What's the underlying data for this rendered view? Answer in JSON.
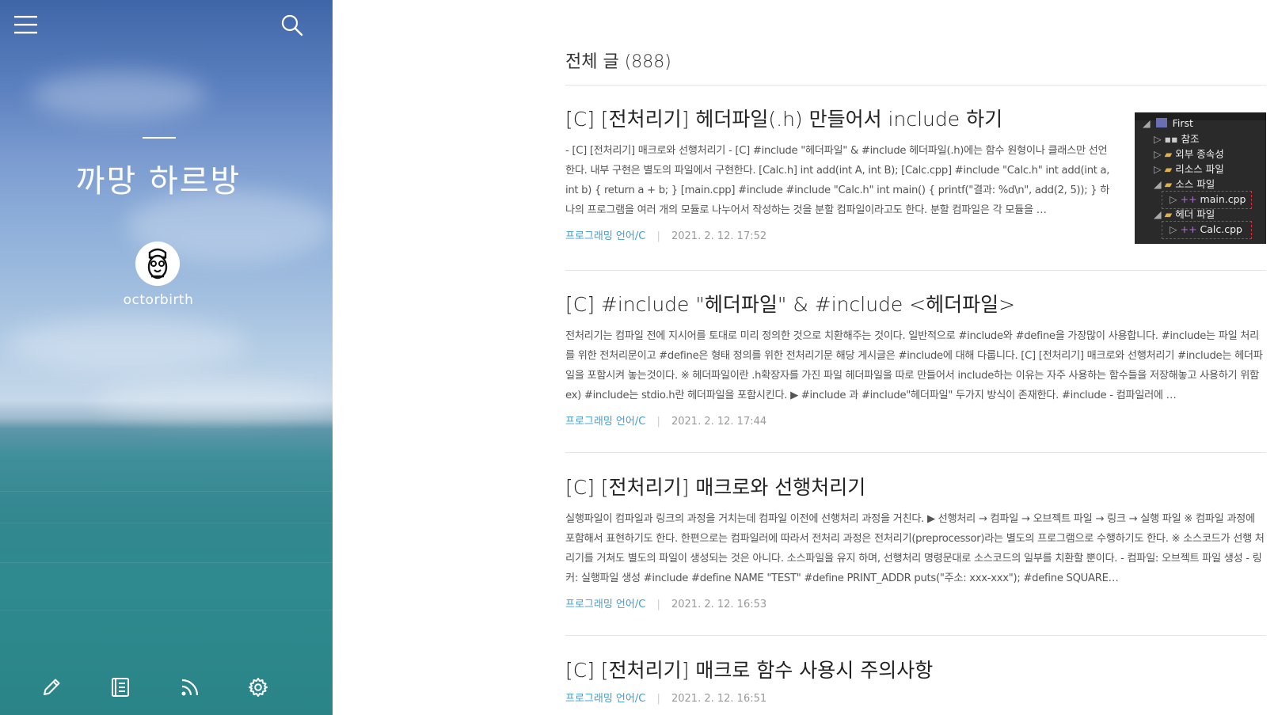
{
  "blog": {
    "title": "까망 하르방",
    "username": "octorbirth"
  },
  "category": {
    "title": "전체 글 (888)"
  },
  "posts": [
    {
      "title": "[C] [전처리기] 헤더파일(.h) 만들어서 include 하기",
      "excerpt": "- [C] [전처리기] 매크로와 선행처리기 - [C] #include \"헤더파일\" & #include 헤더파일(.h)에는 함수 원형이나 클래스만 선언한다. 내부 구현은 별도의 파일에서 구현한다. [Calc.h] int add(int A, int B); [Calc.cpp] #include \"Calc.h\" int add(int a, int b) { return a + b; } [main.cpp] #include #include \"Calc.h\" int main() { printf(\"결과: %d\\n\", add(2, 5)); } 하나의 프로그램을 여러 개의 모듈로 나누어서 작성하는 것을 분할 컴파일이라고도 한다. 분할 컴파일은 각 모듈을 …",
      "category": "프로그래밍 언어/C",
      "date": "2021. 2. 12. 17:52",
      "thumb": {
        "rows": [
          "First",
          "참조",
          "외부 종속성",
          "리소스 파일",
          "소스 파일",
          "main.cpp",
          "헤더 파일",
          "Calc.cpp"
        ]
      }
    },
    {
      "title": "[C] #include \"헤더파일\" & #include <헤더파일>",
      "excerpt": "전처리기는 컴파일 전에 지시어를 토대로 미리 정의한 것으로 치환해주는 것이다. 일반적으로 #include와 #define을 가장많이 사용합니다. #include는 파일 처리를 위한 전처리문이고 #define은 형태 정의를 위한 전처리기문 해당 게시글은 #include에 대해 다룹니다. [C] [전처리기] 매크로와 선행처리기 #include는 헤더파일을 포함시켜 놓는것이다. ※ 헤더파일이란 .h확장자를 가진 파일 헤더파일을 따로 만들어서 include하는 이유는 자주 사용하는 함수들을 저장해놓고 사용하기 위함 ex) #include는 stdio.h란 헤더파일을 포함시킨다. ▶ #include 과 #include\"헤더파일\" 두가지 방식이 존재한다. #include - 컴파일러에 …",
      "category": "프로그래밍 언어/C",
      "date": "2021. 2. 12. 17:44"
    },
    {
      "title": "[C] [전처리기] 매크로와 선행처리기",
      "excerpt": "실행파일이 컴파일과 링크의 과정을 거치는데 컴파일 이전에 선행처리 과정을 거친다. ▶ 선행처리 → 컴파일 → 오브젝트 파일 → 링크 → 실행 파일 ※ 컴파일 과정에 포함해서 표현하기도 한다. 한편으로는 컴파일러에 따라서 전처리 과정은 전처리기(preprocessor)라는 별도의 프로그램으로 수행하기도 한다. ※ 소스코드가 선행 처리기를 거쳐도 별도의 파일이 생성되는 것은 아니다. 소스파일을 유지 하며, 선행처리 명령문대로 소스코드의 일부를 치환할 뿐이다. - 컴파일: 오브젝트 파일 생성 - 링커: 실행파일 생성 #include #define NAME \"TEST\" #define PRINT_ADDR puts(\"주소: xxx-xxx\"); #define SQUARE…",
      "category": "프로그래밍 언어/C",
      "date": "2021. 2. 12. 16:53"
    },
    {
      "title": "[C] [전처리기] 매크로 함수 사용시 주의사항",
      "category": "프로그래밍 언어/C",
      "date": "2021. 2. 12. 16:51"
    }
  ],
  "colors": {
    "accent_link": "#3d9ed4",
    "meta_date": "#999999",
    "title_text": "#222222"
  }
}
